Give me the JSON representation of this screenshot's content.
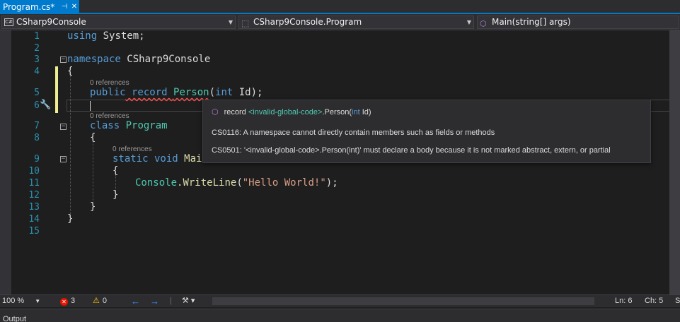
{
  "tab": {
    "title": "Program.cs*",
    "pin_icon": "pin-icon",
    "close_icon": "close-icon"
  },
  "navbar": {
    "project": "CSharp9Console",
    "type": "CSharp9Console.Program",
    "member": "Main(string[] args)"
  },
  "editor": {
    "line_numbers": [
      "1",
      "2",
      "3",
      "4",
      "5",
      "6",
      "7",
      "8",
      "9",
      "10",
      "11",
      "12",
      "13",
      "14",
      "15"
    ],
    "codelens": "0 references",
    "kw_using": "using",
    "ns_system": " System;",
    "kw_namespace": "namespace",
    "ns_name": " CSharp9Console",
    "brace_open": "{",
    "brace_close": "}",
    "kw_public": "public",
    "kw_record": " record ",
    "record_name": "Person",
    "paren_open": "(",
    "kw_int": "int",
    "param": " Id);",
    "kw_class": "class",
    "class_name": " Program",
    "kw_static": "static",
    "kw_void": " void ",
    "method_name": "Mai",
    "console": "Console",
    "dot": ".",
    "writeline": "WriteLine",
    "lp": "(",
    "hello": "\"Hello World!\"",
    "rp": ");"
  },
  "tooltip": {
    "sig_record": "record ",
    "sig_invalid": "<invalid-global-code>",
    "sig_person": ".Person(",
    "sig_int": "int",
    "sig_id": " Id)",
    "error1": "CS0116: A namespace cannot directly contain members such as fields or methods",
    "error2": "CS0501: '<invalid-global-code>.Person(int)' must declare a body because it is not marked abstract, extern, or partial"
  },
  "status": {
    "zoom": "100 %",
    "errors": "3",
    "warnings": "0",
    "ln": "Ln: 6",
    "ch": "Ch: 5",
    "extra": "S"
  },
  "output": {
    "title": "Output"
  },
  "colors": {
    "accent": "#007acc",
    "keyword": "#569cd6",
    "type": "#4ec9b0",
    "string": "#d69d85",
    "error": "#e51400"
  }
}
